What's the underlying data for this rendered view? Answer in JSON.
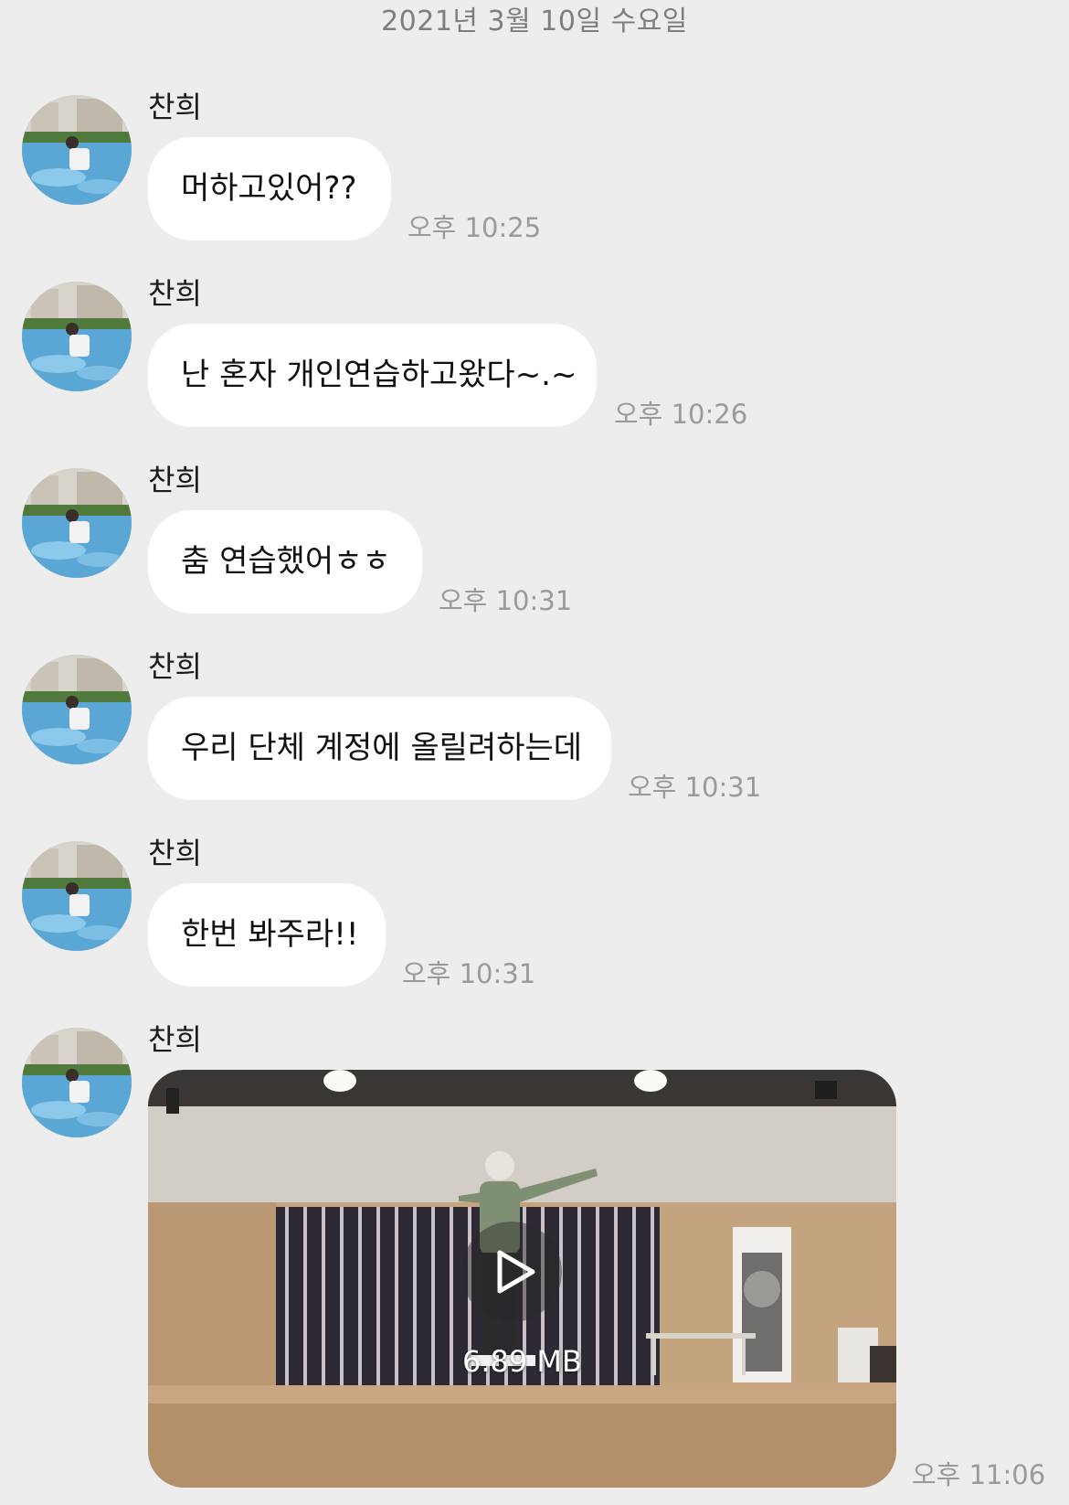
{
  "date_header": "2021년 3월 10일 수요일",
  "messages": [
    {
      "sender": "찬희",
      "text": "머하고있어??",
      "time": "오후 10:25"
    },
    {
      "sender": "찬희",
      "text": "난 혼자 개인연습하고왔다~.~",
      "time": "오후 10:26"
    },
    {
      "sender": "찬희",
      "text": "춤 연습했어ㅎㅎ",
      "time": "오후 10:31"
    },
    {
      "sender": "찬희",
      "text": "우리 단체 계정에 올릴려하는데",
      "time": "오후 10:31"
    },
    {
      "sender": "찬희",
      "text": "한번 봐주라!!",
      "time": "오후 10:31"
    }
  ],
  "video_message": {
    "sender": "찬희",
    "size": "6.89 MB",
    "time": "오후 11:06"
  },
  "icons": {
    "avatar": "profile-photo",
    "play": "play-icon"
  }
}
